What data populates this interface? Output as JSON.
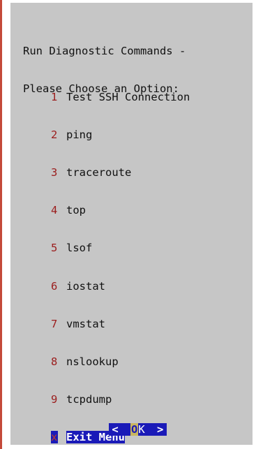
{
  "prompt": {
    "line1": "Run Diagnostic Commands -",
    "line2": "Please Choose an Option:"
  },
  "menu": {
    "items": [
      {
        "key": "1",
        "label": "Test SSH Connection"
      },
      {
        "key": "2",
        "label": "ping"
      },
      {
        "key": "3",
        "label": "traceroute"
      },
      {
        "key": "4",
        "label": "top"
      },
      {
        "key": "5",
        "label": "lsof"
      },
      {
        "key": "6",
        "label": "iostat"
      },
      {
        "key": "7",
        "label": "vmstat"
      },
      {
        "key": "8",
        "label": "nslookup"
      },
      {
        "key": "9",
        "label": "tcpdump"
      },
      {
        "key": "x",
        "label": "Exit Menu",
        "selected": true
      }
    ]
  },
  "buttons": {
    "left_arrow": "<",
    "ok_first": "O",
    "ok_rest": "K",
    "right_arrow": ">"
  },
  "colors": {
    "dialog_bg": "#c6c6c6",
    "highlight": "#1a1ab8",
    "hotkey": "#9b1c1c"
  }
}
